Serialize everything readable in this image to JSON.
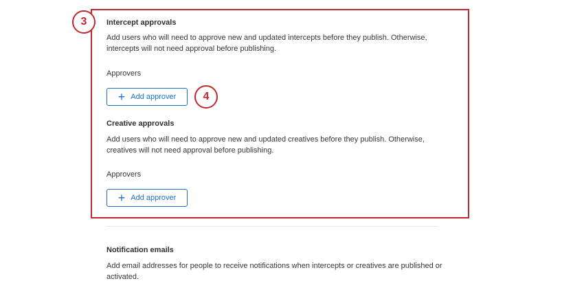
{
  "intercept": {
    "title": "Intercept approvals",
    "desc": "Add users who will need to approve new and updated intercepts before they publish. Otherwise, intercepts will not need approval before publishing.",
    "approvers_label": "Approvers",
    "button": "Add approver"
  },
  "creative": {
    "title": "Creative approvals",
    "desc": "Add users who will need to approve new and updated creatives before they publish. Otherwise, creatives will not need approval before publishing.",
    "approvers_label": "Approvers",
    "button": "Add approver"
  },
  "notification": {
    "title": "Notification emails",
    "desc": "Add email addresses for people to receive notifications when intercepts or creatives are published or activated."
  },
  "callouts": {
    "a": "3",
    "b": "4"
  },
  "colors": {
    "accent": "#1a6fd1",
    "callout": "#c0272d"
  }
}
